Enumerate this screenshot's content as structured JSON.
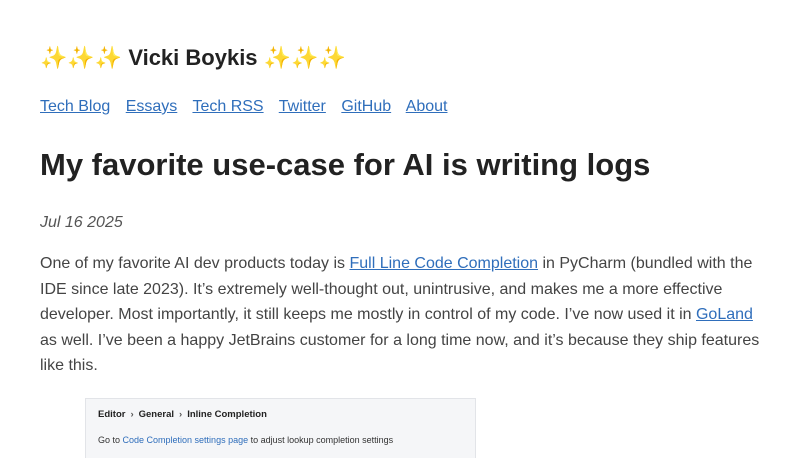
{
  "header": {
    "title_decoration_left": "✨✨✨",
    "title": "Vicki Boykis",
    "title_decoration_right": "✨✨✨"
  },
  "nav": {
    "items": [
      {
        "label": "Tech Blog"
      },
      {
        "label": "Essays"
      },
      {
        "label": "Tech RSS"
      },
      {
        "label": "Twitter"
      },
      {
        "label": "GitHub"
      },
      {
        "label": "About"
      }
    ]
  },
  "post": {
    "title": "My favorite use-case for AI is writing logs",
    "date": "Jul 16 2025",
    "body": {
      "text_1": "One of my favorite AI dev products today is ",
      "link_1": "Full Line Code Completion",
      "text_2": " in PyCharm (bundled with the IDE since late 2023). It’s extremely well-thought out, unintrusive, and makes me a more effective developer. Most importantly, it still keeps me mostly in control of my code. I’ve now used it in ",
      "link_2": "GoLand",
      "text_3": " as well. I’ve been a happy JetBrains customer for a long time now, and it’s because they ship features like this."
    },
    "image": {
      "breadcrumb": [
        "Editor",
        "General",
        "Inline Completion"
      ],
      "breadcrumb_sep": "›",
      "hint_prefix": "Go to ",
      "hint_link": "Code Completion settings page",
      "hint_suffix": " to adjust lookup completion settings"
    }
  },
  "colors": {
    "link": "#2f6ebb",
    "text": "#444444",
    "heading": "#222222"
  }
}
